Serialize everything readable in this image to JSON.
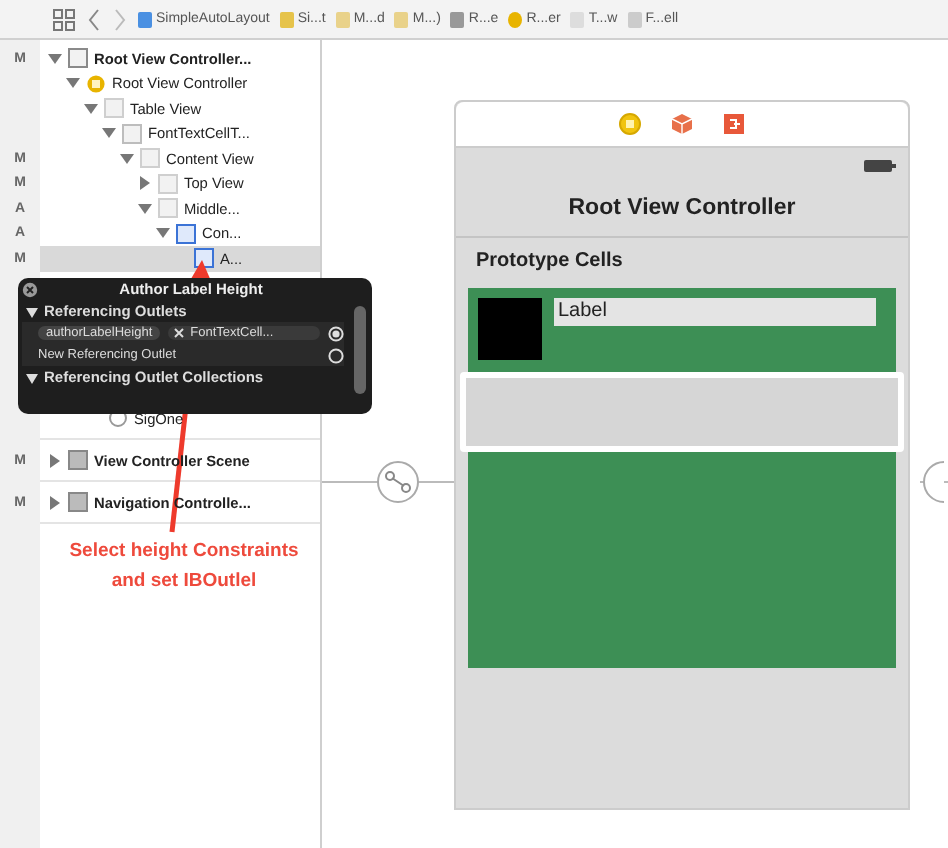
{
  "toolbar": {
    "breadcrumbs": [
      {
        "kind": "file",
        "label": "SimpleAutoLayout"
      },
      {
        "kind": "folder",
        "label": "Si...t"
      },
      {
        "kind": "doc",
        "label": "M...d"
      },
      {
        "kind": "doc",
        "label": "M...)"
      },
      {
        "kind": "scene",
        "label": "R...e"
      },
      {
        "kind": "controller",
        "label": "R...er"
      },
      {
        "kind": "view",
        "label": "T...w"
      },
      {
        "kind": "cell",
        "label": "F...ell"
      }
    ]
  },
  "outline": {
    "items": [
      {
        "label": "Root View Controller...",
        "badge": "M",
        "kind": "scene",
        "expanded": true,
        "selected": false,
        "children": [
          {
            "label": "Root View Controller",
            "kind": "controller",
            "expanded": true,
            "selected": false,
            "children": [
              {
                "label": "Table View",
                "kind": "view",
                "expanded": true,
                "selected": false,
                "children": [
                  {
                    "label": "FontTextCellT...",
                    "kind": "cell",
                    "expanded": true,
                    "selected": false,
                    "children": [
                      {
                        "label": "Content View",
                        "badge": "M",
                        "kind": "view",
                        "expanded": true,
                        "selected": false,
                        "children": [
                          {
                            "label": "Top View",
                            "badge": "M",
                            "kind": "view",
                            "expanded": false,
                            "selected": false
                          },
                          {
                            "label": "Middle...",
                            "badge": "A",
                            "kind": "view",
                            "expanded": true,
                            "selected": false,
                            "children": [
                              {
                                "label": "Con...",
                                "badge": "A",
                                "kind": "constraints",
                                "expanded": true,
                                "selected": false,
                                "children": [
                                  {
                                    "label": "A...",
                                    "badge": "M",
                                    "kind": "constraint",
                                    "selected": true
                                  }
                                ]
                              }
                            ]
                          }
                        ]
                      }
                    ]
                  }
                ]
              }
            ]
          }
        ]
      }
    ],
    "lower_items": [
      {
        "label": "SigOne",
        "kind": "segue"
      },
      {
        "label": "View Controller Scene",
        "badge": "M",
        "kind": "scene",
        "expanded": false
      },
      {
        "label": "Navigation Controlle...",
        "badge": "M",
        "kind": "scene",
        "expanded": false
      }
    ]
  },
  "popup": {
    "title": "Author Label Height",
    "sections": [
      {
        "title": "Referencing Outlets",
        "expanded": true,
        "rows": [
          {
            "kind": "connection",
            "outlet": "authorLabelHeight",
            "target": "FontTextCell...",
            "connected": true
          },
          {
            "kind": "new",
            "label": "New Referencing Outlet",
            "connected": false
          }
        ]
      },
      {
        "title": "Referencing Outlet Collections",
        "expanded": true
      }
    ]
  },
  "annotation": {
    "text": "Select  height  Constraints\nand set IBOutlel"
  },
  "canvas": {
    "scene_title": "Root View Controller",
    "section_header": "Prototype Cells",
    "cell_label": "Label"
  }
}
